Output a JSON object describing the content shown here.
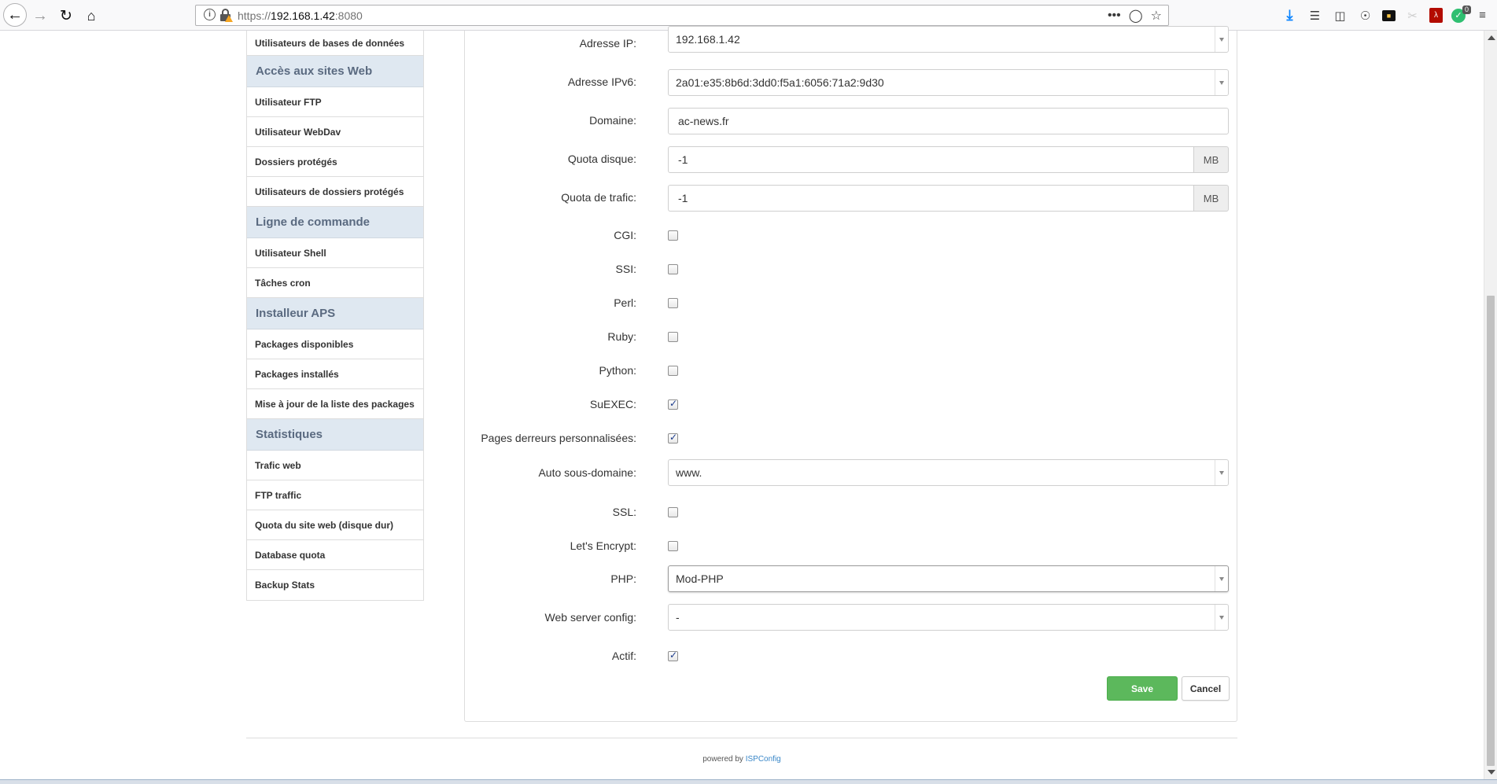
{
  "browser": {
    "url_prefix": "https://",
    "url_host": "192.168.1.42",
    "url_port": ":8080",
    "more_label": "•••",
    "badge_count": "0"
  },
  "sidebar": {
    "items": [
      {
        "type": "item",
        "label": "Utilisateurs de bases de données"
      },
      {
        "type": "head",
        "label": "Accès aux sites Web"
      },
      {
        "type": "item",
        "label": "Utilisateur FTP"
      },
      {
        "type": "item",
        "label": "Utilisateur WebDav"
      },
      {
        "type": "item",
        "label": "Dossiers protégés"
      },
      {
        "type": "item",
        "label": "Utilisateurs de dossiers protégés"
      },
      {
        "type": "head",
        "label": "Ligne de commande"
      },
      {
        "type": "item",
        "label": "Utilisateur Shell"
      },
      {
        "type": "item",
        "label": "Tâches cron"
      },
      {
        "type": "head",
        "label": "Installeur APS"
      },
      {
        "type": "item",
        "label": "Packages disponibles"
      },
      {
        "type": "item",
        "label": "Packages installés"
      },
      {
        "type": "item",
        "label": "Mise à jour de la liste des packages"
      },
      {
        "type": "head",
        "label": "Statistiques"
      },
      {
        "type": "item",
        "label": "Trafic web"
      },
      {
        "type": "item",
        "label": "FTP traffic"
      },
      {
        "type": "item",
        "label": "Quota du site web (disque dur)"
      },
      {
        "type": "item",
        "label": "Database quota"
      },
      {
        "type": "item",
        "label": "Backup Stats"
      }
    ]
  },
  "form": {
    "ip": {
      "label": "Adresse IP:",
      "value": "192.168.1.42"
    },
    "ipv6": {
      "label": "Adresse IPv6:",
      "value": "2a01:e35:8b6d:3dd0:f5a1:6056:71a2:9d30"
    },
    "domain": {
      "label": "Domaine:",
      "value": "ac-news.fr"
    },
    "quota_disk": {
      "label": "Quota disque:",
      "value": "-1",
      "unit": "MB"
    },
    "quota_traffic": {
      "label": "Quota de trafic:",
      "value": "-1",
      "unit": "MB"
    },
    "cgi": {
      "label": "CGI:",
      "checked": false
    },
    "ssi": {
      "label": "SSI:",
      "checked": false
    },
    "perl": {
      "label": "Perl:",
      "checked": false
    },
    "ruby": {
      "label": "Ruby:",
      "checked": false
    },
    "python": {
      "label": "Python:",
      "checked": false
    },
    "suexec": {
      "label": "SuEXEC:",
      "checked": true
    },
    "error_pages": {
      "label": "Pages derreurs personnalisées:",
      "checked": true
    },
    "auto_subdomain": {
      "label": "Auto sous-domaine:",
      "value": "www."
    },
    "ssl": {
      "label": "SSL:",
      "checked": false
    },
    "letsencrypt": {
      "label": "Let's Encrypt:",
      "checked": false
    },
    "php": {
      "label": "PHP:",
      "value": "Mod-PHP"
    },
    "web_server_config": {
      "label": "Web server config:",
      "value": "-"
    },
    "active": {
      "label": "Actif:",
      "checked": true
    },
    "save_label": "Save",
    "cancel_label": "Cancel"
  },
  "footer": {
    "text": "powered by",
    "link": "ISPConfig"
  },
  "colors": {
    "accent_save": "#5cb85c",
    "sidebar_head_bg": "#dfe8f1",
    "link": "#3a87c8"
  }
}
